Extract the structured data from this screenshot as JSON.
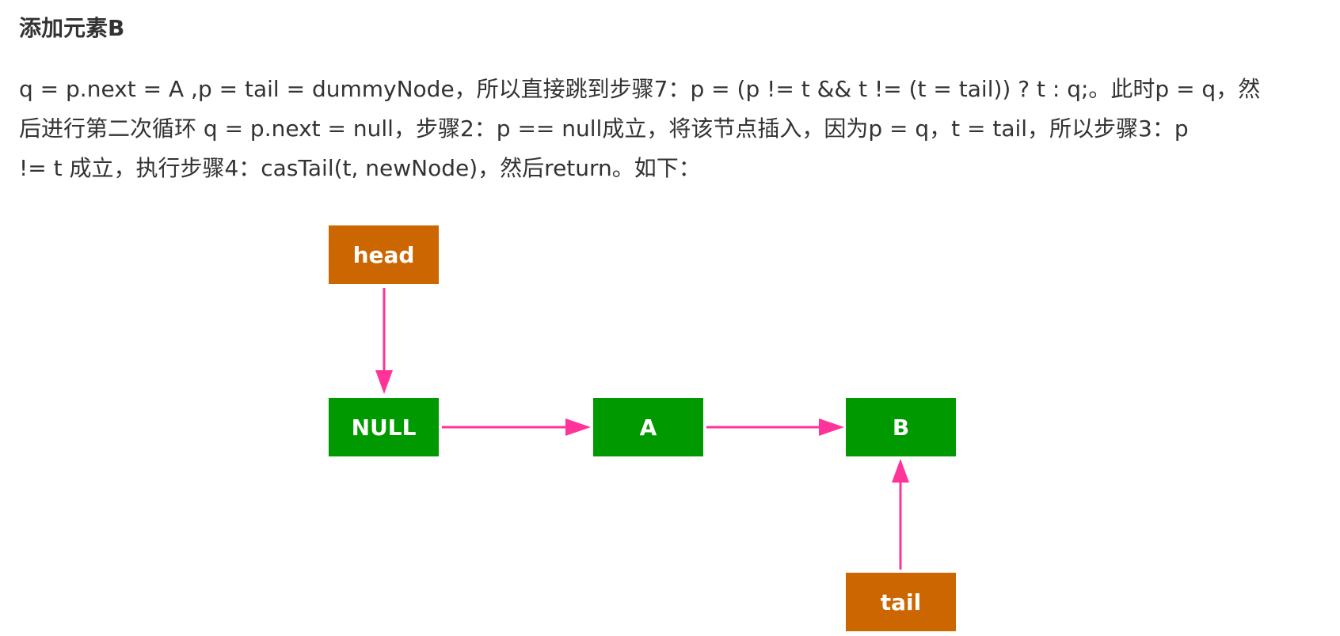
{
  "section": {
    "title": "添加元素B"
  },
  "description": {
    "lines": [
      "q = p.next = A ,p = tail = dummyNode，所以直接跳到步骤7：p = (p != t && t != (t = tail)) ? t : q;。此时p = q，然",
      "后进行第二次循环 q = p.next = null，步骤2：p == null成立，将该节点插入，因为p = q，t = tail，所以步骤3：p",
      "!= t 成立，执行步骤4：casTail(t, newNode)，然后return。如下："
    ]
  },
  "diagram": {
    "colors": {
      "pointer_node": "#cc6600",
      "list_node": "#009900",
      "arrow": "#ff3399",
      "label": "#ffffff"
    },
    "pointers": [
      {
        "id": "head",
        "label": "head"
      },
      {
        "id": "tail",
        "label": "tail"
      }
    ],
    "nodes": [
      {
        "id": "null",
        "label": "NULL"
      },
      {
        "id": "a",
        "label": "A"
      },
      {
        "id": "b",
        "label": "B"
      }
    ],
    "edges": [
      {
        "from": "head",
        "to": "null"
      },
      {
        "from": "null",
        "to": "a"
      },
      {
        "from": "a",
        "to": "b"
      },
      {
        "from": "tail",
        "to": "b"
      }
    ]
  }
}
